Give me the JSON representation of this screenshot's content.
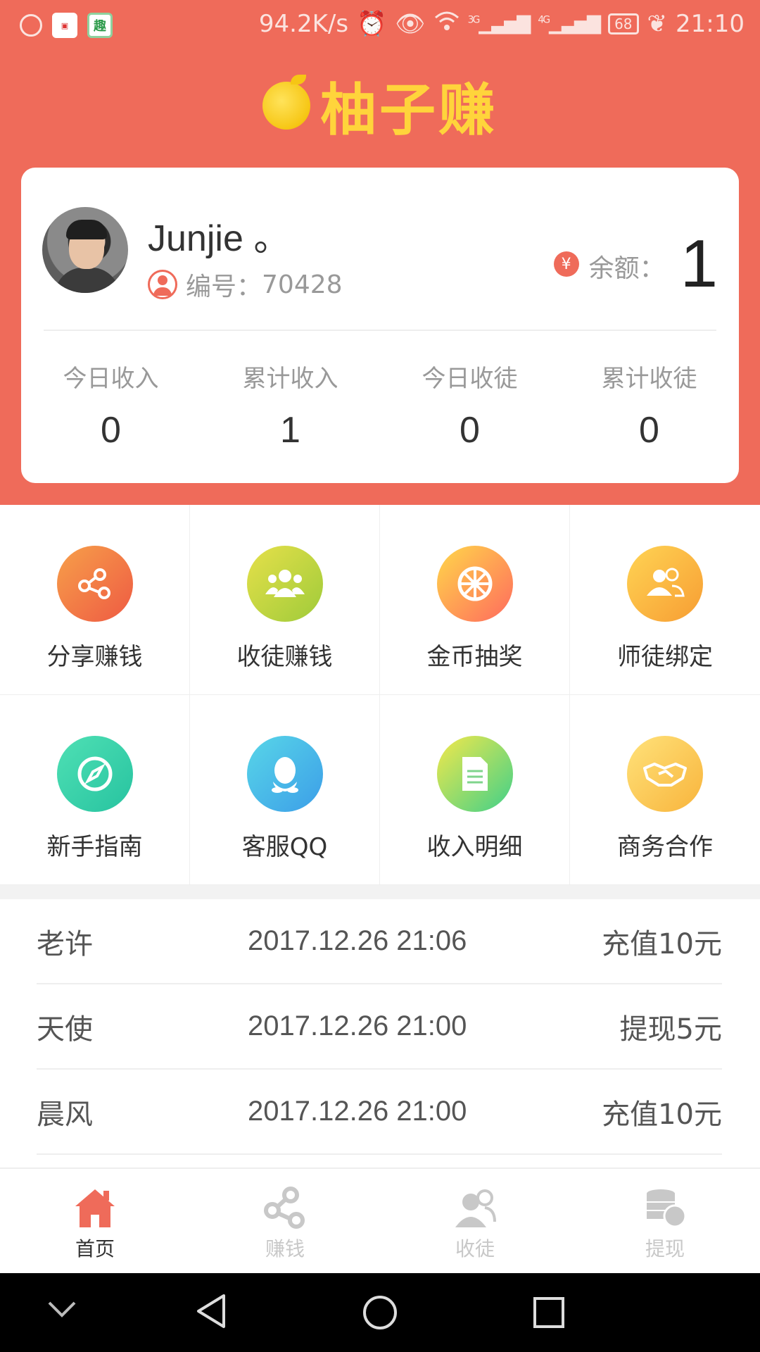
{
  "status_bar": {
    "net_speed": "94.2K/s",
    "sig_3g": "3G",
    "sig_4g": "4G",
    "battery": "68",
    "time": "21:10"
  },
  "brand": {
    "name": "柚子赚"
  },
  "profile": {
    "username": "Junjie 。",
    "id_label": "编号：",
    "id_value": "70428",
    "balance_label": "余额：",
    "balance_value": "1",
    "yen_symbol": "¥",
    "stats": [
      {
        "label": "今日收入",
        "value": "0"
      },
      {
        "label": "累计收入",
        "value": "1"
      },
      {
        "label": "今日收徒",
        "value": "0"
      },
      {
        "label": "累计收徒",
        "value": "0"
      }
    ]
  },
  "grid": [
    {
      "label": "分享赚钱",
      "icon": "share-icon",
      "color_a": "#F7A04A",
      "color_b": "#EE5A43"
    },
    {
      "label": "收徒赚钱",
      "icon": "group-icon",
      "color_a": "#E6E04A",
      "color_b": "#9FCB3A"
    },
    {
      "label": "金币抽奖",
      "icon": "wheel-icon",
      "color_a": "#FFD84A",
      "color_b": "#FF6A5E"
    },
    {
      "label": "师徒绑定",
      "icon": "users-icon",
      "color_a": "#FFD454",
      "color_b": "#F79D33"
    },
    {
      "label": "新手指南",
      "icon": "compass-icon",
      "color_a": "#4FE0B4",
      "color_b": "#27C3A0"
    },
    {
      "label": "客服QQ",
      "icon": "qq-icon",
      "color_a": "#58D6E8",
      "color_b": "#3C9EE8"
    },
    {
      "label": "收入明细",
      "icon": "document-icon",
      "color_a": "#F4E84A",
      "color_b": "#3FD08A"
    },
    {
      "label": "商务合作",
      "icon": "handshake-icon",
      "color_a": "#FFE27A",
      "color_b": "#F8B43C"
    }
  ],
  "records": [
    {
      "name": "老许",
      "time": "2017.12.26 21:06",
      "action": "充值10元"
    },
    {
      "name": "天使",
      "time": "2017.12.26 21:00",
      "action": "提现5元"
    },
    {
      "name": "晨风",
      "time": "2017.12.26 21:00",
      "action": "充值10元"
    }
  ],
  "tabs": [
    {
      "label": "首页",
      "icon": "home-icon",
      "active": true
    },
    {
      "label": "赚钱",
      "icon": "share-icon",
      "active": false
    },
    {
      "label": "收徒",
      "icon": "apprentice-icon",
      "active": false
    },
    {
      "label": "提现",
      "icon": "coins-icon",
      "active": false
    }
  ],
  "colors": {
    "brand": "#EF6B5A",
    "brand_text": "#FFD43B",
    "tab_active": "#EF6B5A",
    "tab_inactive": "#C8C8C8"
  }
}
